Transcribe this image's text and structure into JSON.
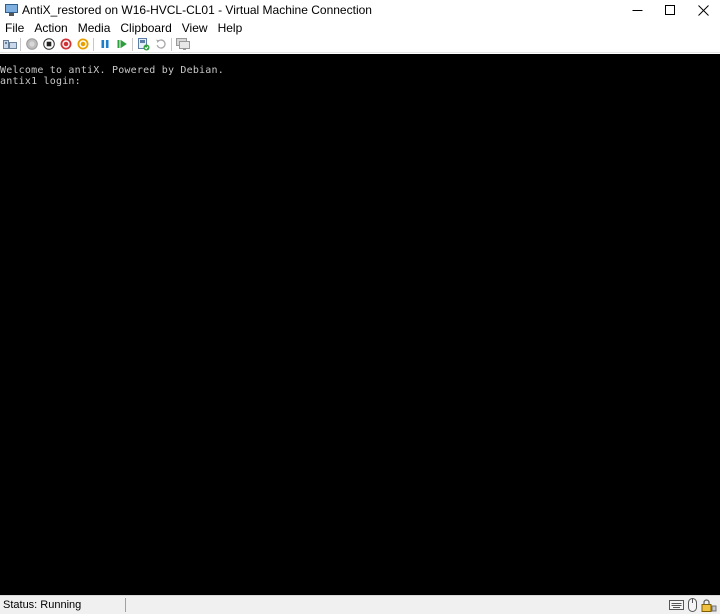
{
  "window": {
    "title": "AntiX_restored on W16-HVCL-CL01 - Virtual Machine Connection",
    "controls": {
      "minimize": "—",
      "maximize": "☐",
      "close": "✕"
    }
  },
  "menu": {
    "items": [
      "File",
      "Action",
      "Media",
      "Clipboard",
      "View",
      "Help"
    ]
  },
  "toolbar": {
    "buttons": [
      {
        "icon": "ctrl-alt-del-icon"
      },
      {
        "icon": "start-icon"
      },
      {
        "icon": "turn-off-icon"
      },
      {
        "icon": "shut-down-icon"
      },
      {
        "icon": "save-state-icon"
      },
      {
        "icon": "pause-icon"
      },
      {
        "icon": "resume-icon"
      },
      {
        "icon": "checkpoint-icon"
      },
      {
        "icon": "revert-icon"
      },
      {
        "icon": "enhanced-session-icon"
      }
    ],
    "colors": {
      "red": "#d13438",
      "orange": "#e8a000",
      "blue": "#1e7ec8",
      "green": "#2e9e3e",
      "gray": "#a0a0a0"
    }
  },
  "console": {
    "lines": [
      "Welcome to antiX. Powered by Debian.",
      "antix1 login:"
    ]
  },
  "status": {
    "text": "Status: Running"
  }
}
